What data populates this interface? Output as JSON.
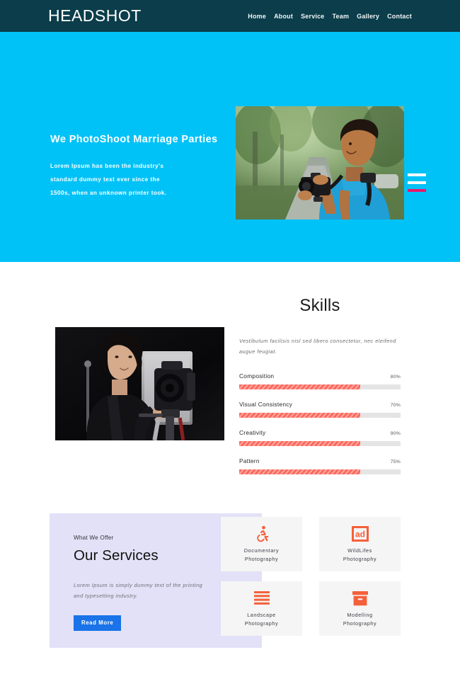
{
  "header": {
    "brand": "HEADSHOT",
    "nav": [
      {
        "label": "Home"
      },
      {
        "label": "About"
      },
      {
        "label": "Service"
      },
      {
        "label": "Team"
      },
      {
        "label": "Gallery"
      },
      {
        "label": "Contact"
      }
    ]
  },
  "hero": {
    "title": "We PhotoShoot Marriage Parties",
    "paragraph_lines": [
      "Lorem Ipsum has been the industry's",
      "standard dummy text ever since the",
      "1500s, when an unknown printer took."
    ],
    "image_alt": "photographer-with-camera-photo",
    "background_color": "#00c2f7",
    "decor_bars": [
      {
        "name": "hero-bar-white-1",
        "color": "#ffffff"
      },
      {
        "name": "hero-bar-white-2",
        "color": "#ffffff"
      },
      {
        "name": "hero-bar-accent",
        "color": "#e8196b"
      }
    ]
  },
  "skills": {
    "heading": "Skills",
    "intro_lines": [
      "Vestibulum facilisis nisl sed libero consectetur, nec eleifend",
      "augue feugiat."
    ],
    "image_alt": "studio-photographer-photo",
    "bar_color": "#fb6a5e",
    "track_color": "#e4e4e4",
    "items": [
      {
        "name": "Composition",
        "percent_label": "80%",
        "fill": 75
      },
      {
        "name": "Visual Consistency",
        "percent_label": "70%",
        "fill": 75
      },
      {
        "name": "Creativity",
        "percent_label": "90%",
        "fill": 75
      },
      {
        "name": "Pattern",
        "percent_label": "75%",
        "fill": 75
      }
    ]
  },
  "services": {
    "eyebrow": "What We Offer",
    "title": "Our Services",
    "text_lines": [
      "Lorem Ipsum is simply dummy text of the printing",
      "and typesetting industry."
    ],
    "button_label": "Read More",
    "button_color": "#1a73e8",
    "panel_color": "#e2e1f7",
    "card_color": "#f5f5f5",
    "icon_color": "#f4603a",
    "cards": [
      {
        "icon": "wheelchair-accessible-icon",
        "line1": "Documentary",
        "line2": "Photography"
      },
      {
        "icon": "ad-box-icon",
        "line1": "WildLifes",
        "line2": "Photography"
      },
      {
        "icon": "align-justify-icon",
        "line1": "Landscape",
        "line2": "Photography"
      },
      {
        "icon": "archive-box-icon",
        "line1": "Modelling",
        "line2": "Photography"
      }
    ]
  }
}
